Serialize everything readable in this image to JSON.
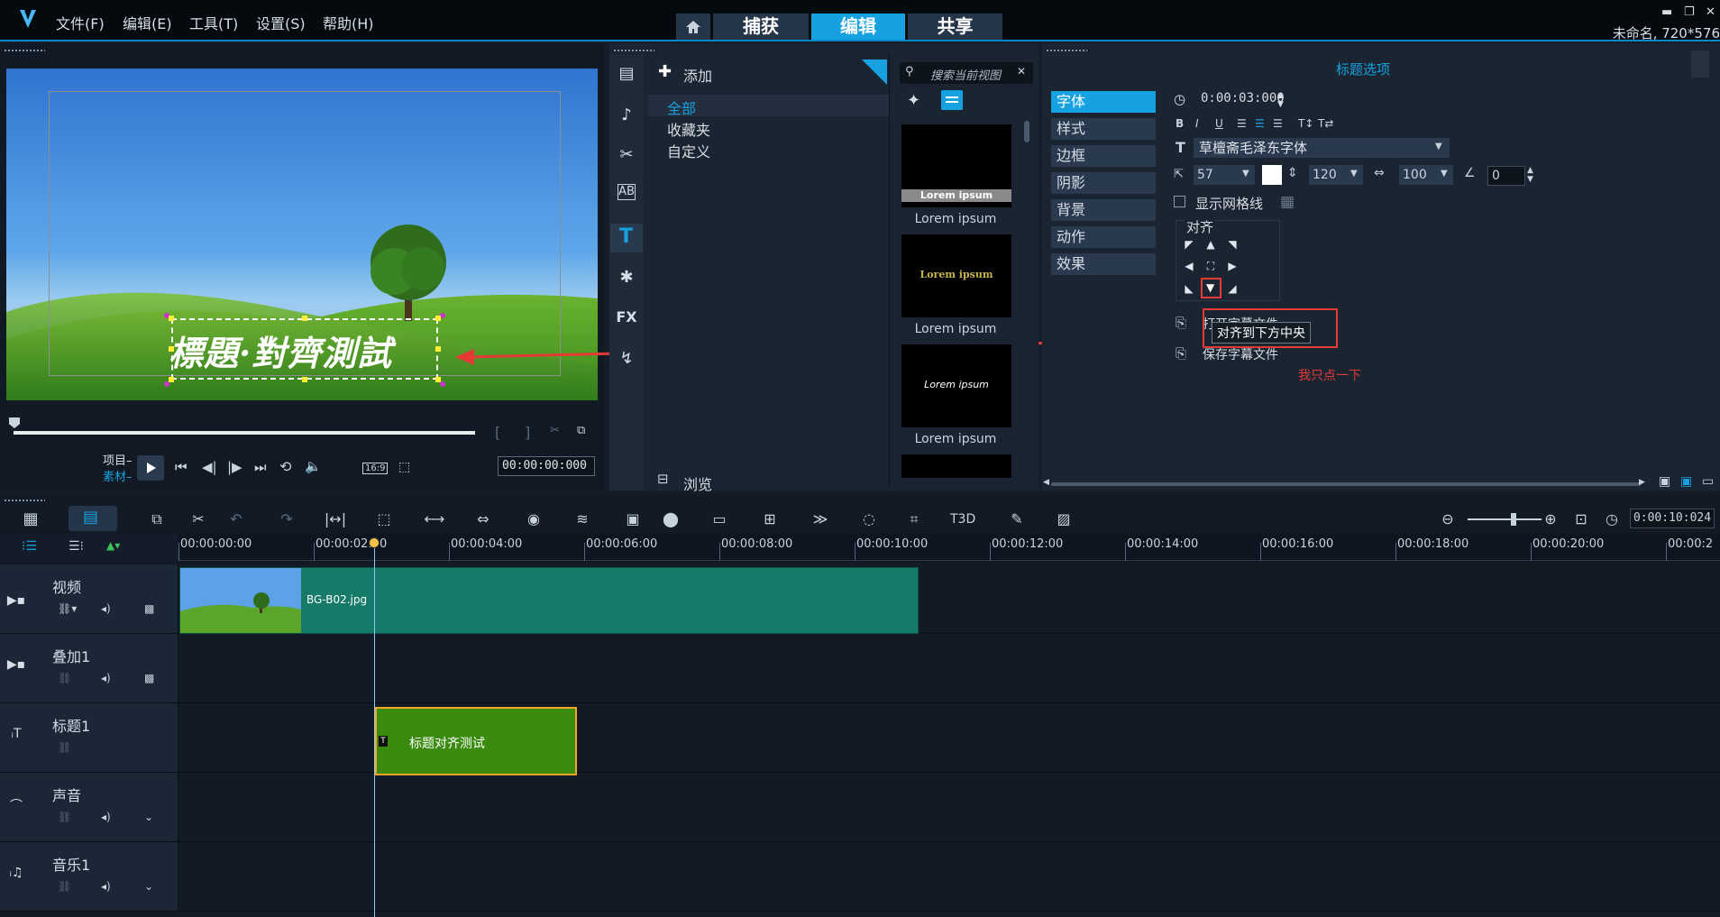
{
  "app": {
    "menu": [
      "文件(F)",
      "编辑(E)",
      "工具(T)",
      "设置(S)",
      "帮助(H)"
    ],
    "tabs": [
      "捕获",
      "编辑",
      "共享"
    ],
    "active_tab": "编辑",
    "window_status": "未命名, 720*576",
    "accent_color": "#16a2e0"
  },
  "preview": {
    "title_text": "標題·對齊測試",
    "project_label": "项目–",
    "clip_label": "素材–",
    "aspect": "16:9",
    "timecode": "00:00:00:000"
  },
  "library": {
    "add_label": "添加",
    "search_placeholder": "搜索当前视图",
    "categories": [
      "全部",
      "收藏夹",
      "自定义"
    ],
    "active_category": "全部",
    "thumbs": [
      {
        "text": "Lorem ipsum",
        "caption": "Lorem ipsum"
      },
      {
        "text": "Lorem ipsum",
        "caption": "Lorem ipsum"
      },
      {
        "text": "Lorem ipsum",
        "caption": "Lorem ipsum"
      }
    ],
    "browse_label": "浏览",
    "fx_label": "FX"
  },
  "options": {
    "header": "标题选项",
    "tabs": [
      "字体",
      "样式",
      "边框",
      "阴影",
      "背景",
      "动作",
      "效果"
    ],
    "active_tab": "字体",
    "duration": "0:00:03:000",
    "font_name": "草檀斋毛泽东字体",
    "font_size": "57",
    "line_spacing": "120",
    "letter_spacing": "100",
    "angle": "0",
    "show_grid_label": "显示网格线",
    "align_label": "对齐",
    "tooltip": "对齐到下方中央",
    "save_subtitle_label": "保存字幕文件",
    "open_subtitle_label": "打开字幕文件",
    "annotation": "我只点一下",
    "annotation_color": "#e53935"
  },
  "timeline": {
    "zoom_timecode": "0:00:10:024",
    "ruler": [
      "00:00:00:00",
      "00:00:02:00",
      "00:00:04:00",
      "00:00:06:00",
      "00:00:08:00",
      "00:00:10:00",
      "00:00:12:00",
      "00:00:14:00",
      "00:00:16:00",
      "00:00:18:00",
      "00:00:20:00",
      "00:00:2"
    ],
    "tracks": [
      {
        "name": "视频"
      },
      {
        "name": "叠加1"
      },
      {
        "name": "标题1"
      },
      {
        "name": "声音"
      },
      {
        "name": "音乐1"
      }
    ],
    "video_clip_label": "BG-B02.jpg",
    "title_clip_label": "标题对齐测试"
  }
}
